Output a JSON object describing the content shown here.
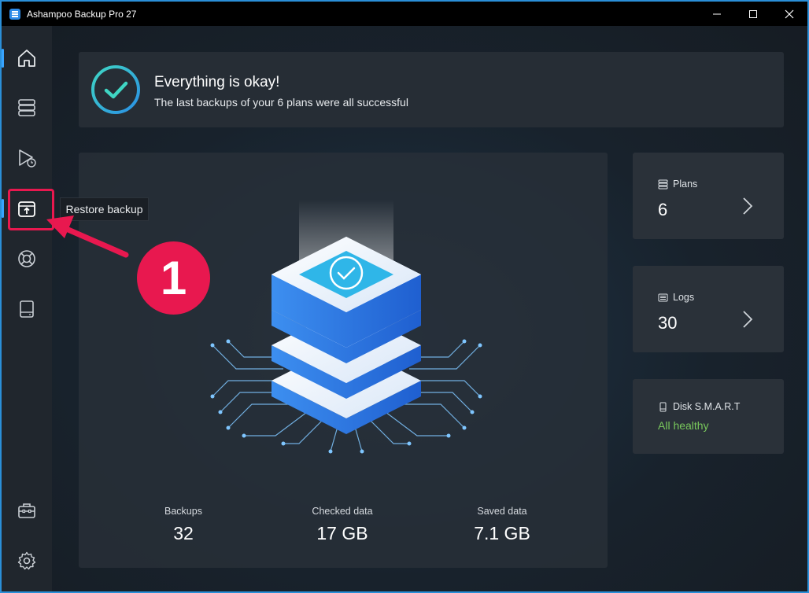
{
  "window": {
    "title": "Ashampoo Backup Pro 27",
    "icons": {
      "logo": "app-logo-icon",
      "minimize": "minimize-icon",
      "maximize": "maximize-icon",
      "close": "close-icon"
    }
  },
  "sidebar": {
    "items": [
      {
        "id": "home",
        "icon": "home-icon",
        "active": true
      },
      {
        "id": "plans",
        "icon": "stack-icon"
      },
      {
        "id": "backup-now",
        "icon": "play-clock-icon"
      },
      {
        "id": "restore",
        "icon": "box-upload-icon",
        "tooltip": "Restore backup"
      },
      {
        "id": "support",
        "icon": "lifebuoy-icon"
      },
      {
        "id": "drive",
        "icon": "drive-icon"
      },
      {
        "id": "toolbox",
        "icon": "toolbox-icon"
      },
      {
        "id": "settings",
        "icon": "gear-icon"
      }
    ],
    "accent_color": "#38a4ff"
  },
  "status": {
    "title": "Everything is okay!",
    "subtitle": "The last backups of your 6 plans were all successful",
    "icon": "check-circle-icon"
  },
  "stats": {
    "backups": {
      "label": "Backups",
      "value": "32"
    },
    "checked": {
      "label": "Checked data",
      "value": "17 GB"
    },
    "saved": {
      "label": "Saved data",
      "value": "7.1 GB"
    }
  },
  "cards": {
    "plans": {
      "label": "Plans",
      "value": "6",
      "icon": "stack-small-icon"
    },
    "logs": {
      "label": "Logs",
      "value": "30",
      "icon": "list-icon"
    },
    "disk": {
      "label": "Disk S.M.A.R.T",
      "status": "All healthy",
      "status_color": "#79c85c",
      "icon": "drive-small-icon"
    }
  },
  "annotation": {
    "number": "1",
    "color": "#e8184f"
  }
}
